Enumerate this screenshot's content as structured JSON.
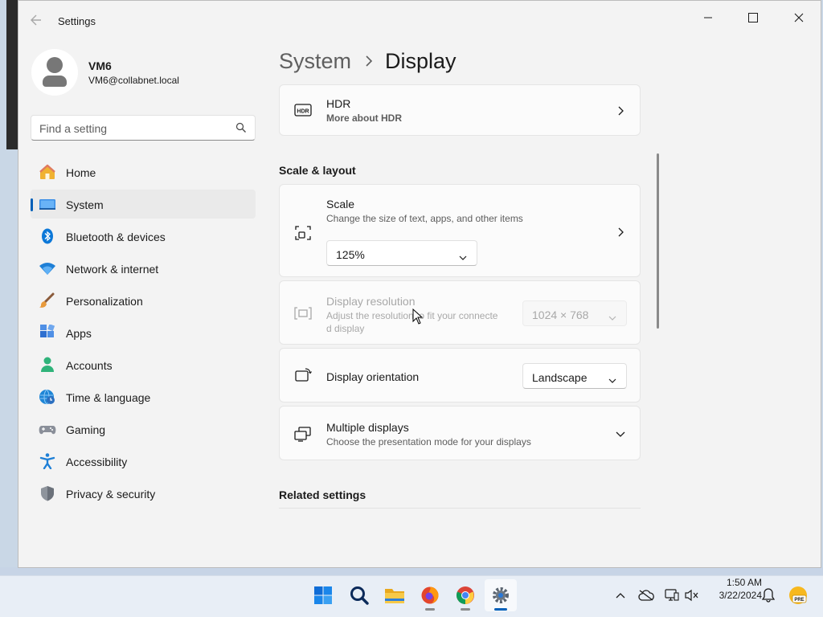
{
  "window": {
    "title": "Settings"
  },
  "user": {
    "name": "VM6",
    "email": "VM6@collabnet.local"
  },
  "search": {
    "placeholder": "Find a setting"
  },
  "nav": {
    "selected": "System",
    "items": [
      {
        "label": "Home",
        "icon": "home-icon"
      },
      {
        "label": "System",
        "icon": "system-icon"
      },
      {
        "label": "Bluetooth & devices",
        "icon": "bluetooth-icon"
      },
      {
        "label": "Network & internet",
        "icon": "wifi-icon"
      },
      {
        "label": "Personalization",
        "icon": "brush-icon"
      },
      {
        "label": "Apps",
        "icon": "apps-icon"
      },
      {
        "label": "Accounts",
        "icon": "accounts-icon"
      },
      {
        "label": "Time & language",
        "icon": "globe-clock-icon"
      },
      {
        "label": "Gaming",
        "icon": "gamepad-icon"
      },
      {
        "label": "Accessibility",
        "icon": "accessibility-icon"
      },
      {
        "label": "Privacy & security",
        "icon": "shield-icon"
      }
    ]
  },
  "breadcrumb": {
    "parent": "System",
    "current": "Display"
  },
  "hdr": {
    "title": "HDR",
    "link": "More about HDR"
  },
  "sections": {
    "scale_layout": "Scale & layout",
    "related": "Related settings"
  },
  "scale": {
    "title": "Scale",
    "subtitle": "Change the size of text, apps, and other items",
    "value": "125%"
  },
  "resolution": {
    "title": "Display resolution",
    "subtitle_line1": "Adjust the resolution to fit your connecte",
    "subtitle_line2": "d display",
    "value": "1024 × 768"
  },
  "orientation": {
    "title": "Display orientation",
    "value": "Landscape"
  },
  "multiple": {
    "title": "Multiple displays",
    "subtitle": "Choose the presentation mode for your displays"
  },
  "taskbar": {
    "apps": [
      "start-icon",
      "search-icon",
      "file-explorer-icon",
      "firefox-icon",
      "chrome-icon",
      "settings-icon"
    ],
    "time": "1:50 AM",
    "date": "3/22/2024",
    "badge": "PRE"
  },
  "colors": {
    "accent": "#005fb8",
    "link": "#003e92",
    "window_bg": "#f3f3f3",
    "card_bg": "#fbfbfb"
  }
}
